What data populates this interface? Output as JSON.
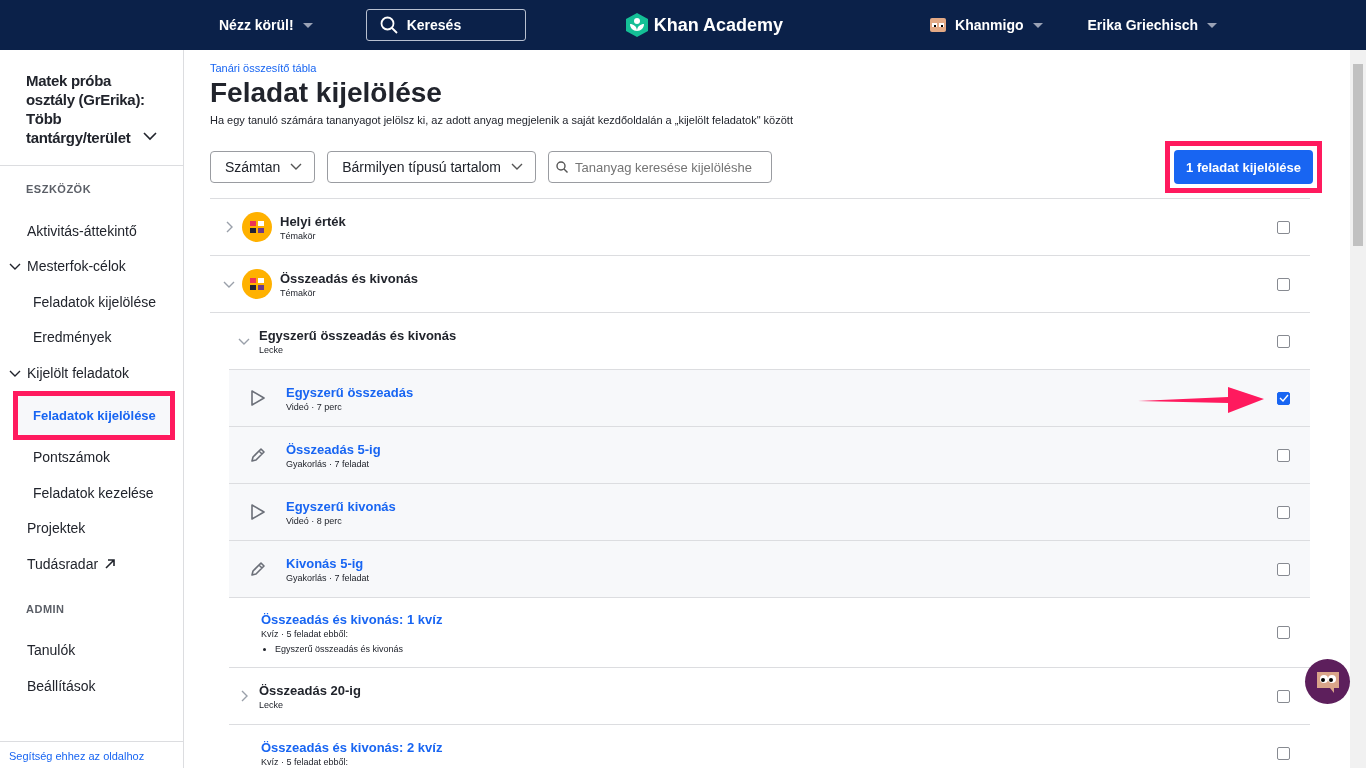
{
  "nav": {
    "explore": "Nézz körül!",
    "search": {
      "placeholder": "Keresés"
    },
    "logo": "Khan Academy",
    "khanmigo": "Khanmigo",
    "user": "Erika Griechisch"
  },
  "sidebar": {
    "class_title": "Matek próba osztály (GrErika): Több tantárgy/terület",
    "sections": [
      {
        "heading": "ESZKÖZÖK",
        "items": [
          {
            "label": "Aktivitás-áttekintő",
            "kind": "link",
            "selected": false
          },
          {
            "label": "Mesterfok-célok",
            "kind": "group",
            "expanded": true,
            "children": [
              {
                "label": "Feladatok kijelölése",
                "kind": "link",
                "selected": false
              },
              {
                "label": "Eredmények",
                "kind": "link",
                "selected": false
              }
            ]
          },
          {
            "label": "Kijelölt feladatok",
            "kind": "group",
            "expanded": true,
            "children": [
              {
                "label": "Feladatok kijelölése",
                "kind": "link",
                "selected": true,
                "highlighted": true
              },
              {
                "label": "Pontszámok",
                "kind": "link",
                "selected": false
              },
              {
                "label": "Feladatok kezelése",
                "kind": "link",
                "selected": false
              }
            ]
          },
          {
            "label": "Projektek",
            "kind": "link",
            "selected": false
          },
          {
            "label": "Tudásradar",
            "kind": "external",
            "selected": false
          }
        ]
      },
      {
        "heading": "ADMIN",
        "items": [
          {
            "label": "Tanulók",
            "kind": "link",
            "selected": false
          },
          {
            "label": "Beállítások",
            "kind": "link",
            "selected": false
          }
        ]
      }
    ],
    "help": "Segítség ehhez az oldalhoz"
  },
  "main": {
    "breadcrumb": "Tanári összesítő tábla",
    "title": "Feladat kijelölése",
    "description": "Ha egy tanuló számára tananyagot jelölsz ki, az adott anyag megjelenik a saját kezdőoldalán a „kijelölt feladatok\" között",
    "filters": [
      {
        "label": "Számtan"
      },
      {
        "label": "Bármilyen típusú tartalom"
      }
    ],
    "search": {
      "placeholder": "Tananyag keresése kijelöléshe"
    },
    "assign_button": {
      "label": "1 feladat kijelölése",
      "highlighted": true
    },
    "rows": [
      {
        "kind": "topic",
        "title": "Helyi érték",
        "subtitle": "Témakör",
        "expanded": false,
        "checked": false
      },
      {
        "kind": "topic",
        "title": "Összeadás és kivonás",
        "subtitle": "Témakör",
        "expanded": true,
        "checked": false,
        "children": [
          {
            "kind": "lesson",
            "title": "Egyszerű összeadás és kivonás",
            "subtitle": "Lecke",
            "expanded": true,
            "checked": false,
            "children": [
              {
                "kind": "video",
                "title": "Egyszerű összeadás",
                "subtitle": "Videó · 7 perc",
                "checked": true,
                "arrow": true
              },
              {
                "kind": "exercise",
                "title": "Összeadás 5-ig",
                "subtitle": "Gyakorlás · 7 feladat",
                "checked": false
              },
              {
                "kind": "video",
                "title": "Egyszerű kivonás",
                "subtitle": "Videó · 8 perc",
                "checked": false
              },
              {
                "kind": "exercise",
                "title": "Kivonás 5-ig",
                "subtitle": "Gyakorlás · 7 feladat",
                "checked": false
              }
            ]
          },
          {
            "kind": "quiz",
            "title": "Összeadás és kivonás: 1 kvíz",
            "subtitle": "Kvíz · 5 feladat ebből:",
            "bullets": [
              "Egyszerű összeadás és kivonás"
            ],
            "checked": false
          },
          {
            "kind": "lesson",
            "title": "Összeadás 20-ig",
            "subtitle": "Lecke",
            "expanded": false,
            "checked": false
          },
          {
            "kind": "quiz",
            "title": "Összeadás és kivonás: 2 kvíz",
            "subtitle": "Kvíz · 5 feladat ebből:",
            "checked": false
          }
        ]
      }
    ]
  }
}
